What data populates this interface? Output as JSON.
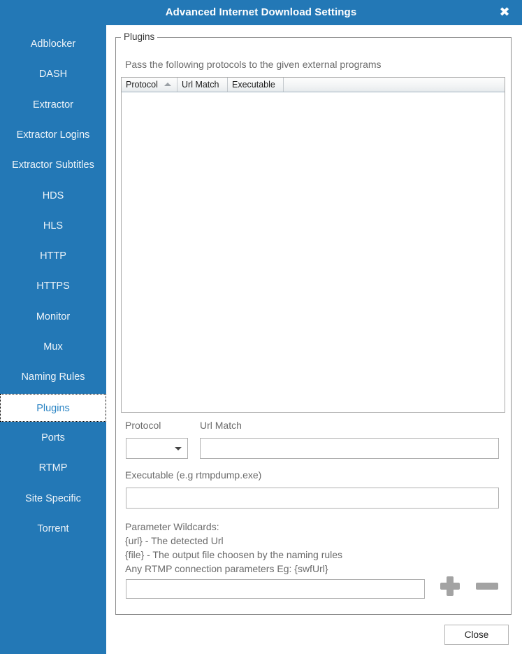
{
  "window": {
    "title": "Advanced Internet Download Settings",
    "close_icon": "close-x-icon",
    "accent_color": "#2378b6"
  },
  "sidebar": {
    "items": [
      {
        "label": "Adblocker",
        "selected": false
      },
      {
        "label": "DASH",
        "selected": false
      },
      {
        "label": "Extractor",
        "selected": false
      },
      {
        "label": "Extractor Logins",
        "selected": false
      },
      {
        "label": "Extractor Subtitles",
        "selected": false
      },
      {
        "label": "HDS",
        "selected": false
      },
      {
        "label": "HLS",
        "selected": false
      },
      {
        "label": "HTTP",
        "selected": false
      },
      {
        "label": "HTTPS",
        "selected": false
      },
      {
        "label": "Monitor",
        "selected": false
      },
      {
        "label": "Mux",
        "selected": false
      },
      {
        "label": "Naming Rules",
        "selected": false
      },
      {
        "label": "Plugins",
        "selected": true
      },
      {
        "label": "Ports",
        "selected": false
      },
      {
        "label": "RTMP",
        "selected": false
      },
      {
        "label": "Site Specific",
        "selected": false
      },
      {
        "label": "Torrent",
        "selected": false
      }
    ],
    "selected_text_color": "#2a84c4"
  },
  "main": {
    "group_label": "Plugins",
    "description": "Pass the following protocols to the given external programs",
    "table": {
      "columns": [
        {
          "label": "Protocol",
          "sort": "ascending",
          "sort_icon": "sort-ascending-icon"
        },
        {
          "label": "Url Match",
          "sort": "none"
        },
        {
          "label": "Executable",
          "sort": "none"
        }
      ],
      "rows": []
    },
    "form": {
      "protocol_label": "Protocol",
      "protocol_value": "",
      "protocol_dropdown_icon": "chevron-down-icon",
      "url_match_label": "Url Match",
      "url_match_value": "",
      "url_match_placeholder": "",
      "executable_label": "Executable (e.g rtmpdump.exe)",
      "executable_value": "",
      "executable_placeholder": "",
      "parameters_value": "",
      "parameters_placeholder": "",
      "add_icon": "plus-icon",
      "remove_icon": "minus-icon"
    },
    "wildcards": {
      "line1": "Parameter Wildcards:",
      "line2": "{url} - The detected Url",
      "line3": "{file} - The output file choosen by the naming rules",
      "line4": "Any RTMP connection parameters Eg: {swfUrl}"
    }
  },
  "footer": {
    "close_label": "Close"
  }
}
